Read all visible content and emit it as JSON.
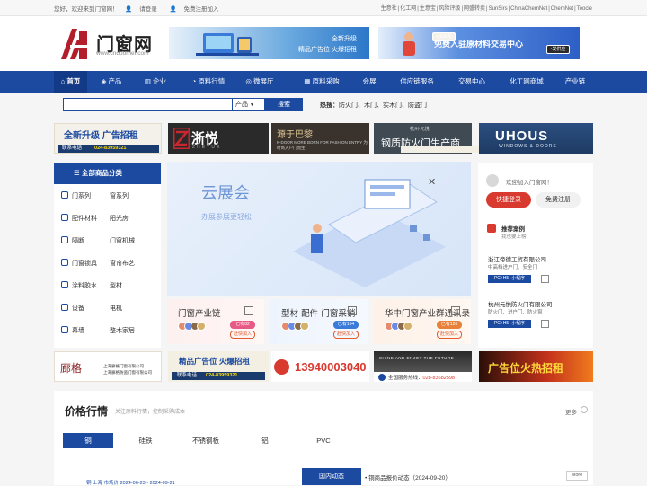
{
  "topbar": {
    "welcome": "您好，欢迎来到门窗网！",
    "login": "请登录",
    "register": "免费注册加入",
    "links": [
      "生意社",
      "化工网",
      "生意宝",
      "风险评级",
      "网盛转卖",
      "SunSirs",
      "ChinaChemNet",
      "ChemNet",
      "Toocle"
    ]
  },
  "header": {
    "logo_text": "门窗网",
    "logo_url": "www.cndoornet.com",
    "ad1": {
      "line1": "全新升级",
      "line2": "精品广告位 火爆招租"
    },
    "ad2": {
      "title": "免费入驻原材料交易中心",
      "btn1": "•找采购",
      "btn2": "•发供应"
    }
  },
  "nav": [
    "首页",
    "产品",
    "企业",
    "原料行情",
    "微展厅",
    "原料采购",
    "会展",
    "供应链服务",
    "交易中心",
    "化工网商城",
    "产业链"
  ],
  "search": {
    "placeholder": "",
    "select": "产品",
    "button": "搜索",
    "hot_label": "热搜：",
    "hot_items": "防火门、木门、实木门、防盗门"
  },
  "banners": {
    "b1": {
      "title": "全新升级  广告招租",
      "phone_label": "联系电话",
      "phone": "024-83959321"
    },
    "b2": {
      "title": "浙悦",
      "sub": "ZHEYUE"
    },
    "b3": {
      "title": "源于巴黎",
      "sub": "K-DOOR MORE BORN FOR FASHION ENTRY  为时尚入户门而生"
    },
    "b4": {
      "top": "杭州·元悦",
      "title": "钢质防火门生产商",
      "sub": "您选我放在门外"
    },
    "b5": {
      "title": "UHOUS",
      "sub": "WINDOWS & DOORS"
    }
  },
  "categories": {
    "header": "全部商品分类",
    "rows": [
      [
        "门系列",
        "窗系列"
      ],
      [
        "配件材料",
        "阳光房"
      ],
      [
        "隔断",
        "门窗机械"
      ],
      [
        "门窗锁具",
        "窗帘布艺"
      ],
      [
        "涂料胶水",
        "型材"
      ],
      [
        "设备",
        "电机"
      ],
      [
        "幕墙",
        "整木家居"
      ]
    ]
  },
  "hero": {
    "title": "云展会",
    "subtitle": "办展参展更轻松",
    "close": "✕"
  },
  "cards": [
    {
      "title": "门窗产业链",
      "badge": "已有82",
      "join": "赶快加入",
      "color": "#e85a86"
    },
    {
      "title": "型材·配件·门窗采销",
      "badge": "已有164",
      "join": "赶快加入",
      "color": "#3a7ad8"
    },
    {
      "title": "华中门窗产业群通讯录",
      "badge": "已有126",
      "join": "赶快加入",
      "color": "#e8823a"
    }
  ],
  "user": {
    "welcome": "欢迎加入门窗网！",
    "login": "快捷登录",
    "register": "免费注册",
    "rec_title": "推荐案例",
    "rec_sub": "我也要上榜",
    "companies": [
      {
        "name": "浙江帝德工贸有限公司",
        "scope": "中高档进户门、安全门",
        "tag": "PC+H5+小程序"
      },
      {
        "name": "杭州元悦防火门有限公司",
        "scope": "防火门、进户门、防火窗",
        "tag": "PC+H5+小程序"
      }
    ]
  },
  "strips": {
    "s1": {
      "title": "廊格",
      "line1": "上海廊格门窗有限公司",
      "line2": "上海廊格防盗门窗有限公司"
    },
    "s2": {
      "title": "精品广告位  火爆招租",
      "phone_label": "联系电话",
      "phone": "024-83959321"
    },
    "s3": {
      "phone": "13940003040"
    },
    "s4": {
      "title": "SHINE AND ENJOY THE FUTURE",
      "hotline_label": "全国服务热线：",
      "hotline": "028-83682598"
    },
    "s5": {
      "title": "广告位火热招租"
    }
  },
  "price": {
    "title": "价格行情",
    "subtitle": "关注原料行情，控制采购成本",
    "more": "更多",
    "tabs": [
      "铜",
      "硅铁",
      "不锈钢板",
      "铝",
      "PVC"
    ],
    "line_text": "铜 上海 市场价 2024-06-23 - 2024-09-21",
    "domestic": "国内动态",
    "dyn_item": "铜商品报价动态（2024-09-20）",
    "more_btn": "More"
  },
  "colors": {
    "primary": "#1c4aa0",
    "accent": "#d83a2f"
  }
}
